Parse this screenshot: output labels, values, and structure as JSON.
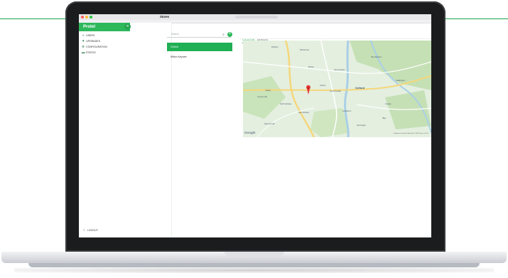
{
  "browser": {
    "tab_title": "Locations"
  },
  "sidebar": {
    "brand": "Protel",
    "collapse_icon": "«",
    "items": [
      {
        "label": "USERS",
        "icon": "☺"
      },
      {
        "label": "UPDRADES",
        "icon": "▼"
      },
      {
        "label": "CONFIGURATION",
        "icon": "⚙"
      },
      {
        "label": "STATUS",
        "icon": "▬"
      }
    ],
    "logout": "LOGOUT"
  },
  "main": {
    "title": "Stores",
    "search_placeholder": "Search",
    "search_icon": "⌕",
    "add_icon": "+",
    "stores": [
      {
        "label": "Oxford",
        "active": true
      },
      {
        "label": "Milton Keynes",
        "active": false
      }
    ],
    "tabs": [
      {
        "label": "LOCATION",
        "active": true
      },
      {
        "label": "DEVICES",
        "active": false
      }
    ]
  },
  "map": {
    "places": [
      "Oxford",
      "Botley",
      "Cumnor Hill",
      "Wolvercote",
      "New Marston",
      "Headington",
      "Summertown",
      "Cowley",
      "New Hinksey",
      "Kennington",
      "Harcourt Hill",
      "Oxford Castle",
      "Jericho",
      "Iffley",
      "North Hinksey",
      "Wytham",
      "Grandpont",
      "Binsey"
    ],
    "attribution": "Google",
    "footer": "Keyboard shortcuts  Map data ©2018  Terms of Use",
    "colors": {
      "water": "#a9cfe6",
      "park": "#c5e0b5",
      "road": "#f5d77a",
      "pin": "#e53935"
    }
  }
}
